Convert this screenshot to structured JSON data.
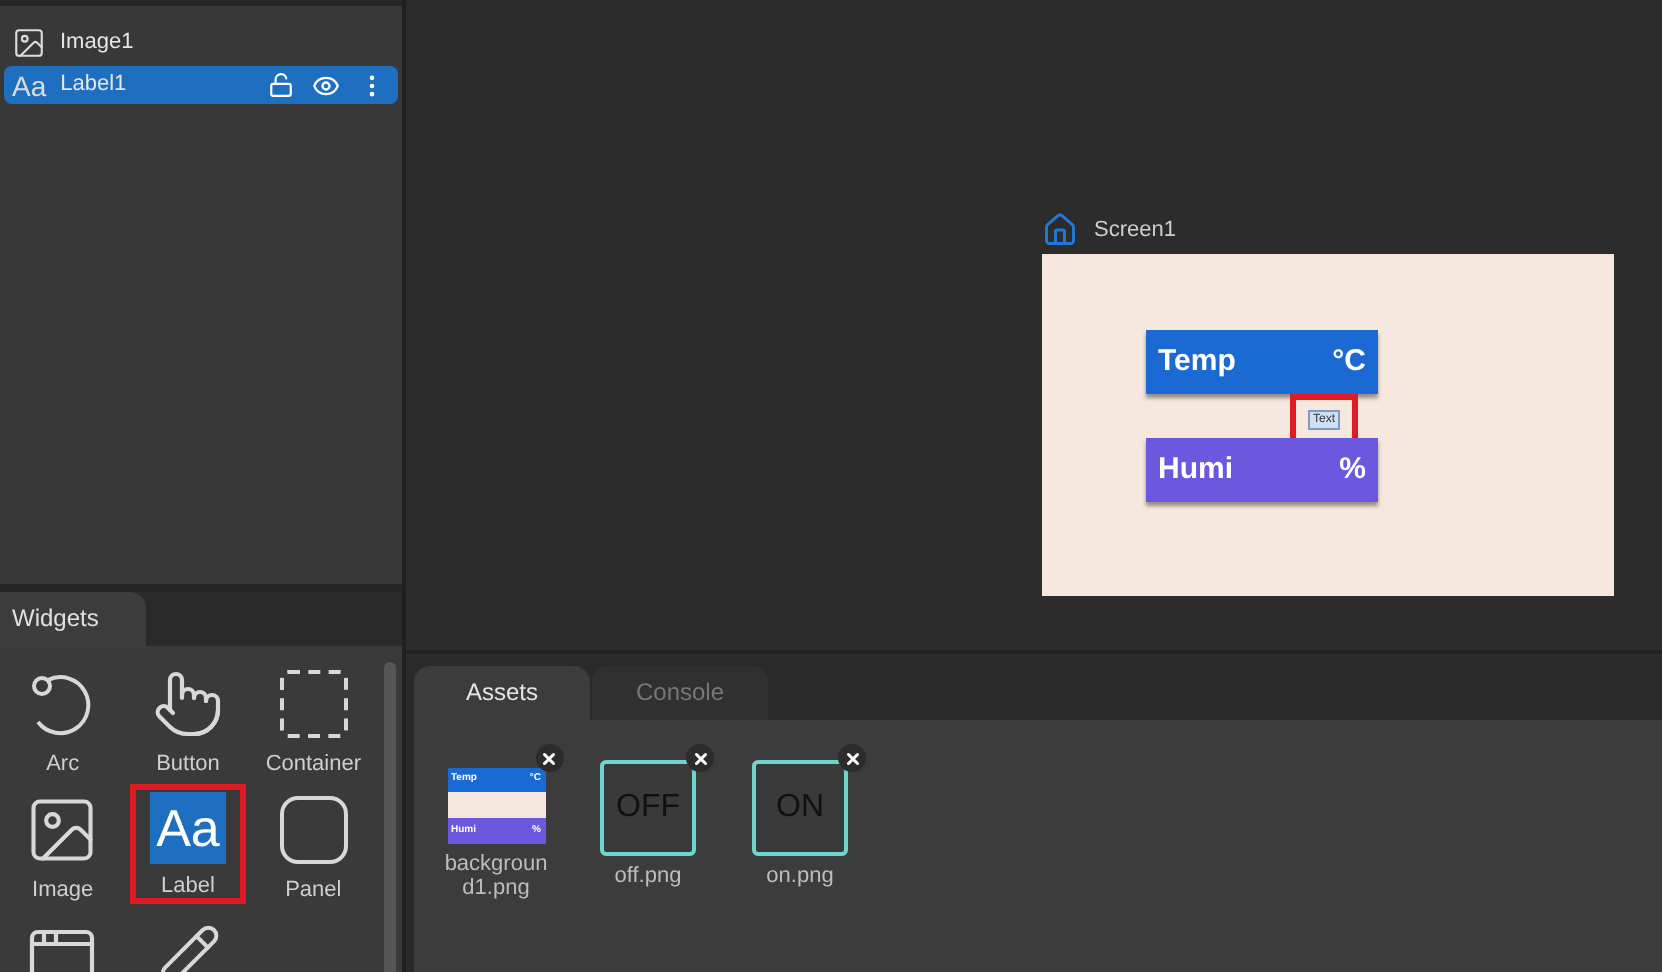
{
  "layers": [
    {
      "name": "Image1",
      "kind": "image",
      "selected": false
    },
    {
      "name": "Label1",
      "kind": "label",
      "glyph": "Aa",
      "selected": true
    }
  ],
  "canvas": {
    "screen_name": "Screen1",
    "bars": [
      {
        "label": "Temp",
        "unit": "°C",
        "color": "#1b6ad3"
      },
      {
        "label": "Humi",
        "unit": "%",
        "color": "#6a58de"
      }
    ],
    "text_label": "Text",
    "text_label_highlighted": true
  },
  "widgets_panel": {
    "title": "Widgets",
    "items": [
      {
        "kind": "arc",
        "label": "Arc",
        "selected": false
      },
      {
        "kind": "button",
        "label": "Button",
        "selected": false
      },
      {
        "kind": "container",
        "label": "Container",
        "selected": false
      },
      {
        "kind": "image",
        "label": "Image",
        "selected": false
      },
      {
        "kind": "label",
        "label": "Label",
        "glyph": "Aa",
        "selected": true
      },
      {
        "kind": "panel",
        "label": "Panel",
        "selected": false
      },
      {
        "kind": "window",
        "selected": false
      },
      {
        "kind": "pencil",
        "selected": false
      }
    ]
  },
  "bottom_tabs": [
    {
      "label": "Assets",
      "selected": true
    },
    {
      "label": "Console",
      "selected": false
    }
  ],
  "assets": [
    {
      "name": "background1.png",
      "kind": "background",
      "thumb": [
        "Temp",
        "°C",
        "Humi",
        "%"
      ]
    },
    {
      "name": "off.png",
      "kind": "toggle",
      "thumb_text": "OFF"
    },
    {
      "name": "on.png",
      "kind": "toggle",
      "thumb_text": "ON"
    }
  ]
}
